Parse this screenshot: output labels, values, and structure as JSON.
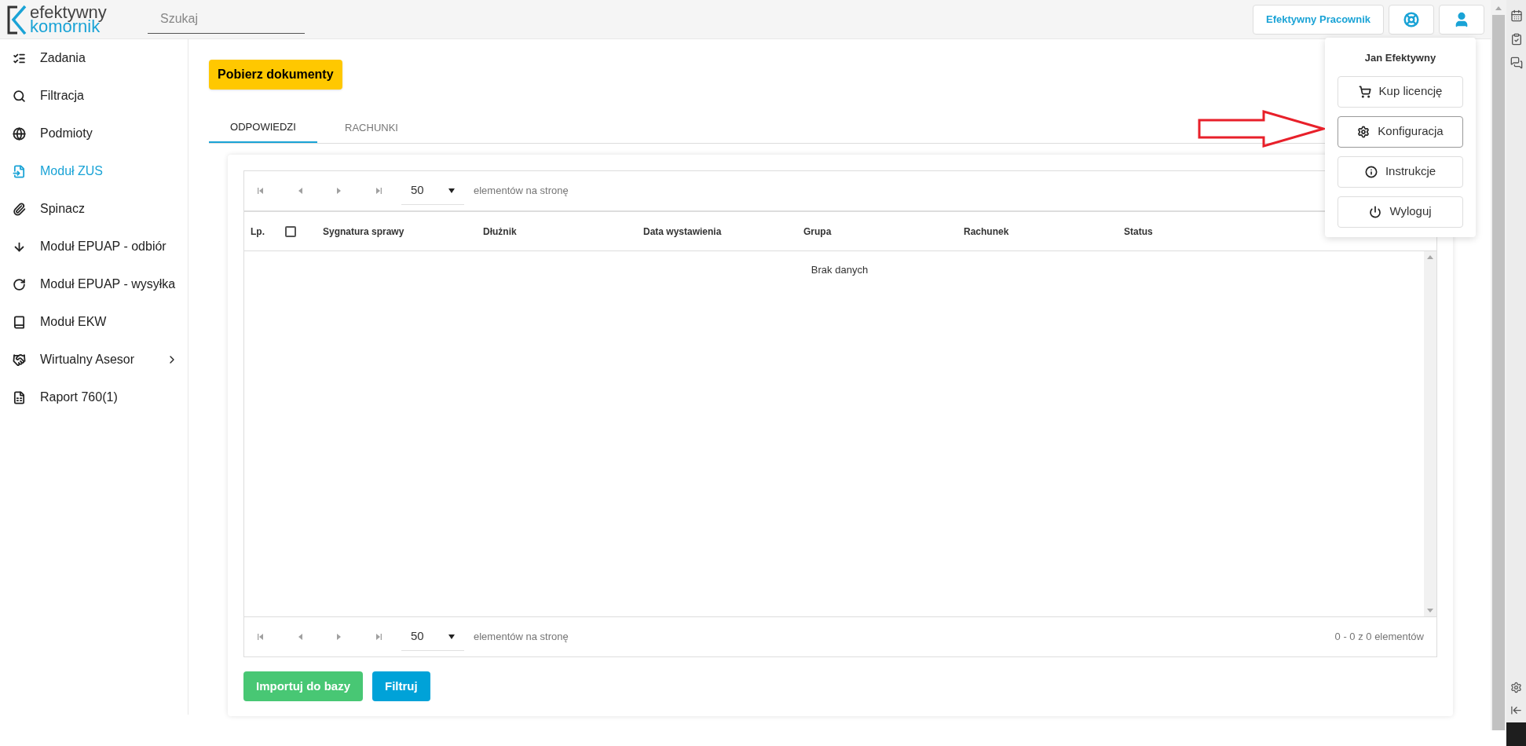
{
  "header": {
    "logo": {
      "line_1": "efektywny",
      "line_2": "komornik"
    },
    "search": {
      "placeholder": "Szukaj"
    },
    "user_button": "Efektywny Pracownik"
  },
  "sidebar": {
    "items": [
      {
        "label": "Zadania",
        "selected": false,
        "has_submenu": false
      },
      {
        "label": "Filtracja",
        "selected": false,
        "has_submenu": false
      },
      {
        "label": "Podmioty",
        "selected": false,
        "has_submenu": false
      },
      {
        "label": "Moduł ZUS",
        "selected": true,
        "has_submenu": false
      },
      {
        "label": "Spinacz",
        "selected": false,
        "has_submenu": false
      },
      {
        "label": "Moduł EPUAP - odbiór",
        "selected": false,
        "has_submenu": false
      },
      {
        "label": "Moduł EPUAP - wysyłka",
        "selected": false,
        "has_submenu": false
      },
      {
        "label": "Moduł EKW",
        "selected": false,
        "has_submenu": false
      },
      {
        "label": "Wirtualny Asesor",
        "selected": false,
        "has_submenu": true
      },
      {
        "label": "Raport 760(1)",
        "selected": false,
        "has_submenu": false
      }
    ]
  },
  "download_button": "Pobierz dokumenty",
  "tabs": [
    {
      "label": "ODPOWIEDZI",
      "selected": true
    },
    {
      "label": "RACHUNKI",
      "selected": false
    }
  ],
  "grid": {
    "pager_top": {
      "page_size": "50",
      "label": "elementów na stronę"
    },
    "columns": [
      {
        "kind": "text",
        "label": "Lp."
      },
      {
        "kind": "checkbox",
        "checked": false
      },
      {
        "kind": "text",
        "label": "Sygnatura sprawy"
      },
      {
        "kind": "text",
        "label": "Dłużnik"
      },
      {
        "kind": "text",
        "label": "Data wystawienia"
      },
      {
        "kind": "text",
        "label": "Grupa"
      },
      {
        "kind": "text",
        "label": "Rachunek"
      },
      {
        "kind": "text",
        "label": "Status"
      }
    ],
    "empty_message": "Brak danych",
    "pager_bottom": {
      "page_size": "50",
      "label": "elementów na stronę",
      "summary": "0 - 0 z 0 elementów"
    }
  },
  "buttons": [
    {
      "label": "Importuj do bazy",
      "kind": "success"
    },
    {
      "label": "Filtruj",
      "kind": "primary"
    }
  ],
  "user_menu": {
    "name": "Jan Efektywny",
    "items": [
      {
        "label": "Kup licencję",
        "selected": false
      },
      {
        "label": "Konfiguracja",
        "selected": true
      },
      {
        "label": "Instrukcje",
        "selected": false
      },
      {
        "label": "Wyloguj",
        "selected": false
      }
    ]
  }
}
